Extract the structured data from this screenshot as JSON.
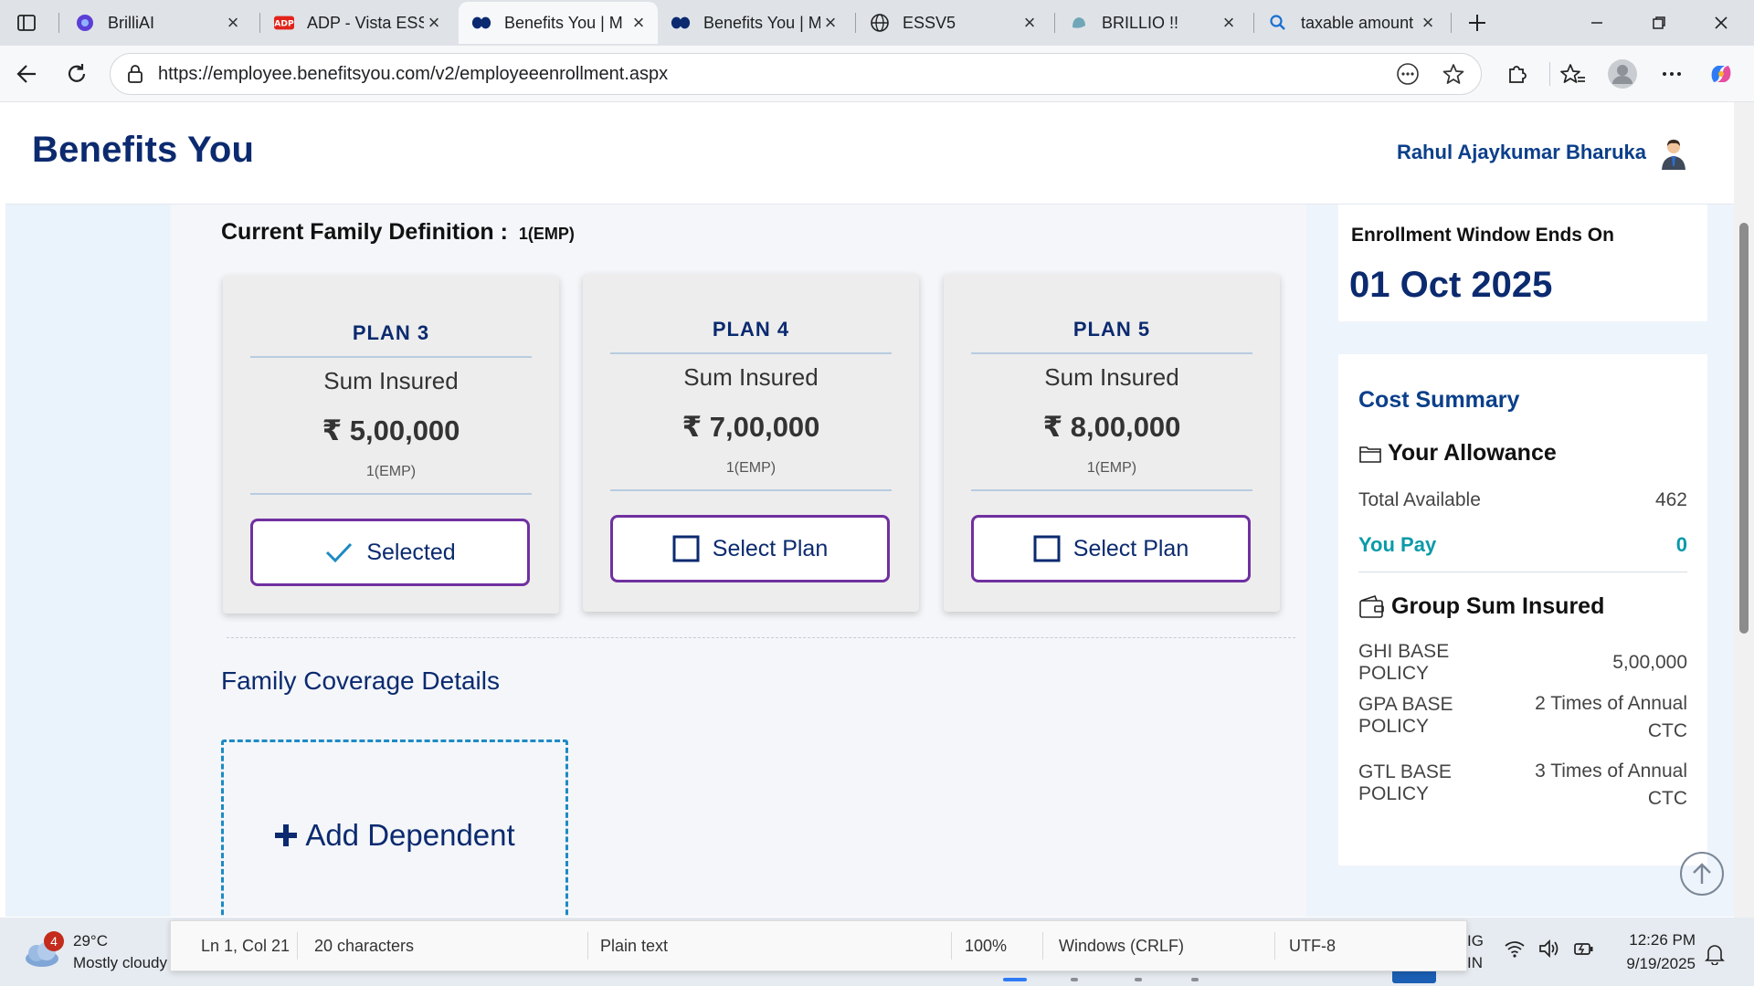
{
  "browser": {
    "tabs": [
      {
        "title": "BrilliAI",
        "active": false
      },
      {
        "title": "ADP - Vista ESS",
        "active": false
      },
      {
        "title": "Benefits You | M",
        "active": true
      },
      {
        "title": "Benefits You | M",
        "active": false
      },
      {
        "title": "ESSV5",
        "active": false
      },
      {
        "title": "BRILLIO !!",
        "active": false
      },
      {
        "title": "taxable amount",
        "active": false
      }
    ],
    "url": "https://employee.benefitsyou.com/v2/employeeenrollment.aspx"
  },
  "header": {
    "brand": "Benefits You",
    "user_name": "Rahul Ajaykumar Bharuka"
  },
  "family_definition": {
    "label": "Current Family Definition :",
    "value": "1(EMP)"
  },
  "plans": [
    {
      "name": "PLAN 3",
      "sum_label": "Sum Insured",
      "amount": "₹ 5,00,000",
      "definition": "1(EMP)",
      "button": "Selected",
      "selected": true
    },
    {
      "name": "PLAN 4",
      "sum_label": "Sum Insured",
      "amount": "₹ 7,00,000",
      "definition": "1(EMP)",
      "button": "Select Plan",
      "selected": false
    },
    {
      "name": "PLAN 5",
      "sum_label": "Sum Insured",
      "amount": "₹ 8,00,000",
      "definition": "1(EMP)",
      "button": "Select Plan",
      "selected": false
    }
  ],
  "coverage": {
    "title": "Family Coverage Details",
    "add_dependent": "Add Dependent"
  },
  "enrollment": {
    "title": "Enrollment Window Ends On",
    "date": "01 Oct 2025"
  },
  "cost_summary": {
    "title": "Cost Summary",
    "allowance_title": "Your Allowance",
    "total_available_label": "Total Available",
    "total_available_value": "462",
    "you_pay_label": "You Pay",
    "you_pay_value": "0",
    "group_title": "Group Sum Insured",
    "group_rows": [
      {
        "label": "GHI BASE POLICY",
        "value": "5,00,000"
      },
      {
        "label": "GPA BASE POLICY",
        "value": "2 Times of Annual CTC"
      },
      {
        "label": "GTL BASE POLICY",
        "value": "3 Times of Annual CTC"
      }
    ]
  },
  "statusbar": {
    "position": "Ln 1, Col 21",
    "characters": "20 characters",
    "format": "Plain text",
    "zoom": "100%",
    "line_ending": "Windows (CRLF)",
    "encoding": "UTF-8"
  },
  "taskbar": {
    "weather_badge": "4",
    "temperature": "29°C",
    "condition": "Mostly cloudy",
    "lang_top": "IG",
    "lang_bottom": "IN",
    "time": "12:26 PM",
    "date": "9/19/2025"
  },
  "colors": {
    "brand_navy": "#0b2a6f",
    "button_border": "#7030a0",
    "accent_teal": "#0a9aa8",
    "dashed_blue": "#1e8ac4"
  }
}
